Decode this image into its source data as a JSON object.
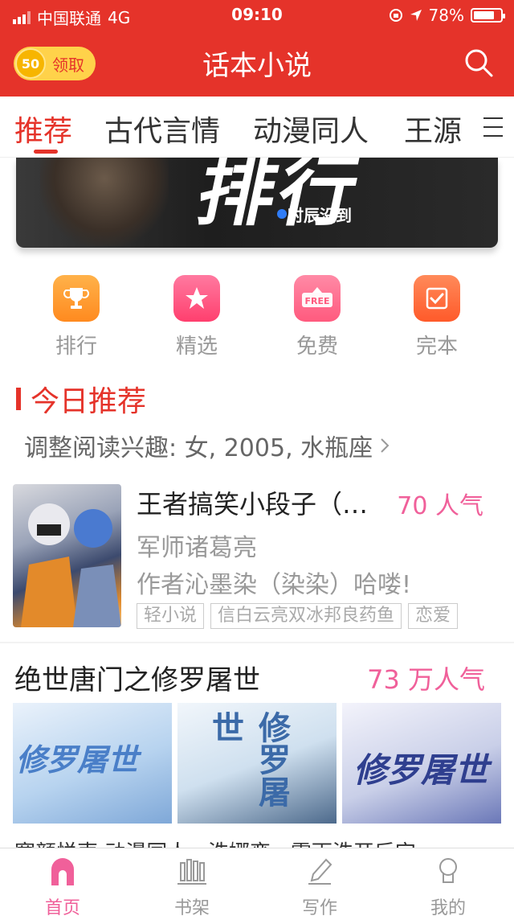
{
  "status": {
    "carrier": "中国联通",
    "network": "4G",
    "time": "09:10",
    "battery": "78%"
  },
  "header": {
    "coin_count": "50",
    "coin_label": "领取",
    "title": "话本小说"
  },
  "tabs": [
    {
      "label": "推荐"
    },
    {
      "label": "古代言情"
    },
    {
      "label": "动漫同人"
    },
    {
      "label": "王源"
    }
  ],
  "banner": {
    "caption": "时辰没到"
  },
  "quick_entries": [
    {
      "label": "排行",
      "icon": "trophy-icon",
      "color": "#ff9a2e"
    },
    {
      "label": "精选",
      "icon": "star-icon",
      "color": "#ff5c8a"
    },
    {
      "label": "免费",
      "icon": "free-icon",
      "color": "#ff6f8f"
    },
    {
      "label": "完本",
      "icon": "check-icon",
      "color": "#ff6a3d"
    }
  ],
  "section": {
    "title": "今日推荐",
    "interest": "调整阅读兴趣: 女, 2005, 水瓶座"
  },
  "book1": {
    "title": "王者搞笑小段子（…",
    "popularity": "70 人气",
    "line1": "军师诸葛亮",
    "line2": "作者沁墨染（染染）哈喽!",
    "tags": [
      "轻小说",
      "信白云亮双冰邦良药鱼",
      "恋爱"
    ]
  },
  "book2": {
    "title": "绝世唐门之修罗屠世",
    "popularity": "73 万人气",
    "peek": "寒颜悦声 动漫同人 · 洗娜变 · 需雨洗开后宫"
  },
  "bottom_nav": [
    {
      "label": "首页",
      "icon": "home-icon"
    },
    {
      "label": "书架",
      "icon": "bookshelf-icon"
    },
    {
      "label": "写作",
      "icon": "pen-icon"
    },
    {
      "label": "我的",
      "icon": "profile-icon"
    }
  ],
  "colors": {
    "primary": "#e5332a",
    "pink": "#f0609a",
    "coin": "#ffd24a"
  }
}
